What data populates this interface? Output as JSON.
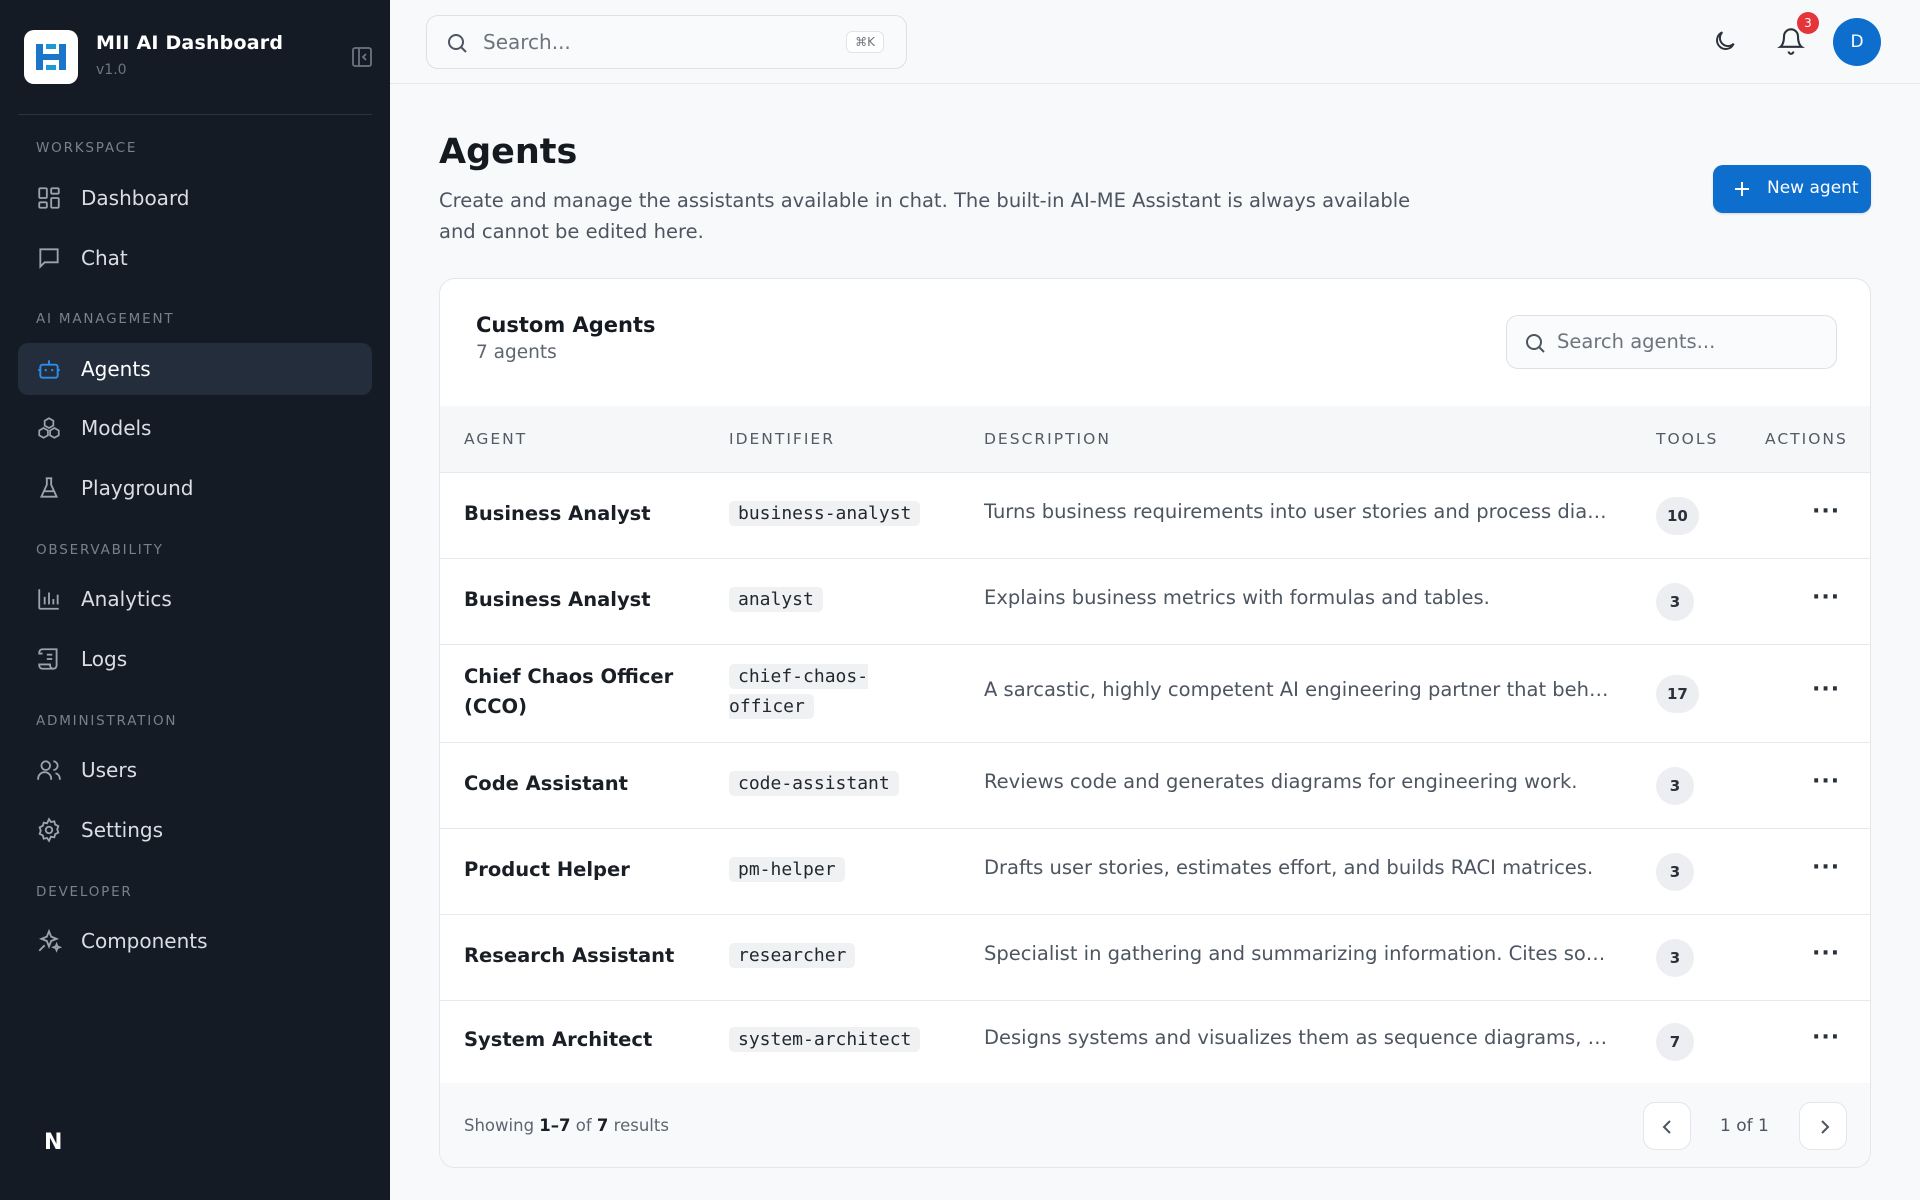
{
  "app": {
    "title": "MII AI Dashboard",
    "version": "v1.0"
  },
  "sidebar": {
    "sections": [
      {
        "title": "WORKSPACE",
        "items": [
          {
            "label": "Dashboard",
            "icon": "dashboard-grid-icon"
          },
          {
            "label": "Chat",
            "icon": "chat-bubble-icon"
          }
        ]
      },
      {
        "title": "AI MANAGEMENT",
        "items": [
          {
            "label": "Agents",
            "icon": "robot-icon",
            "active": true
          },
          {
            "label": "Models",
            "icon": "models-cube-icon"
          },
          {
            "label": "Playground",
            "icon": "flask-icon"
          }
        ]
      },
      {
        "title": "OBSERVABILITY",
        "items": [
          {
            "label": "Analytics",
            "icon": "bar-chart-icon"
          },
          {
            "label": "Logs",
            "icon": "scroll-icon"
          }
        ]
      },
      {
        "title": "ADMINISTRATION",
        "items": [
          {
            "label": "Users",
            "icon": "users-icon"
          },
          {
            "label": "Settings",
            "icon": "gear-icon"
          }
        ]
      },
      {
        "title": "DEVELOPER",
        "items": [
          {
            "label": "Components",
            "icon": "sparkles-icon"
          }
        ]
      }
    ],
    "footer_logo": "N"
  },
  "topbar": {
    "search_placeholder": "Search...",
    "search_shortcut": "⌘K",
    "notification_count": "3",
    "avatar_initial": "D"
  },
  "page": {
    "title": "Agents",
    "description": "Create and manage the assistants available in chat. The built-in AI-ME Assistant is always available and cannot be edited here.",
    "new_button": "New agent"
  },
  "card": {
    "title": "Custom Agents",
    "subtitle": "7 agents",
    "search_placeholder": "Search agents...",
    "columns": [
      "AGENT",
      "IDENTIFIER",
      "DESCRIPTION",
      "TOOLS",
      "ACTIONS"
    ],
    "rows": [
      {
        "name": "Business Analyst",
        "identifier": "business-analyst",
        "description": "Turns business requirements into user stories and process diagr...",
        "tools": "10"
      },
      {
        "name": "Business Analyst",
        "identifier": "analyst",
        "description": "Explains business metrics with formulas and tables.",
        "tools": "3"
      },
      {
        "name": "Chief Chaos Officer (CCO)",
        "identifier": "chief-chaos-officer",
        "description": "A sarcastic, highly competent AI engineering partner that behav...",
        "tools": "17"
      },
      {
        "name": "Code Assistant",
        "identifier": "code-assistant",
        "description": "Reviews code and generates diagrams for engineering work.",
        "tools": "3"
      },
      {
        "name": "Product Helper",
        "identifier": "pm-helper",
        "description": "Drafts user stories, estimates effort, and builds RACI matrices.",
        "tools": "3"
      },
      {
        "name": "Research Assistant",
        "identifier": "researcher",
        "description": "Specialist in gathering and summarizing information. Cites sour...",
        "tools": "3"
      },
      {
        "name": "System Architect",
        "identifier": "system-architect",
        "description": "Designs systems and visualizes them as sequence diagrams, ER...",
        "tools": "7"
      }
    ],
    "footer": {
      "showing_prefix": "Showing",
      "range": "1–7",
      "of": "of",
      "total": "7",
      "suffix": "results",
      "page_text": "1 of 1"
    }
  },
  "colors": {
    "accent": "#0d6ecd",
    "sidebar_bg": "#141b24",
    "badge": "#e5343a"
  }
}
